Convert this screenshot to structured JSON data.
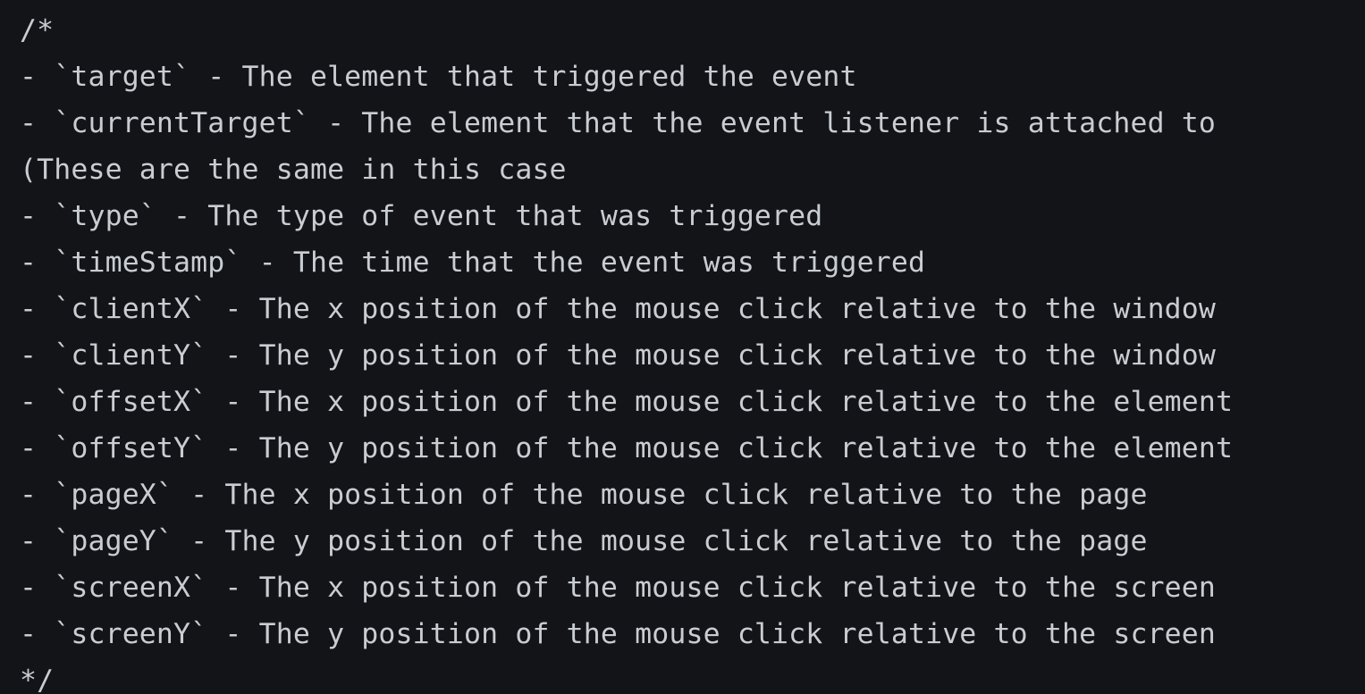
{
  "editor": {
    "lines": [
      "/*",
      "- `target` - The element that triggered the event",
      "- `currentTarget` - The element that the event listener is attached to",
      "(These are the same in this case",
      "- `type` - The type of event that was triggered",
      "- `timeStamp` - The time that the event was triggered",
      "- `clientX` - The x position of the mouse click relative to the window",
      "- `clientY` - The y position of the mouse click relative to the window",
      "- `offsetX` - The x position of the mouse click relative to the element",
      "- `offsetY` - The y position of the mouse click relative to the element",
      "- `pageX` - The x position of the mouse click relative to the page",
      "- `pageY` - The y position of the mouse click relative to the page",
      "- `screenX` - The x position of the mouse click relative to the screen",
      "- `screenY` - The y position of the mouse click relative to the screen",
      "*/"
    ]
  },
  "colors": {
    "background": "#121418",
    "comment_text": "#c9cdd2"
  }
}
